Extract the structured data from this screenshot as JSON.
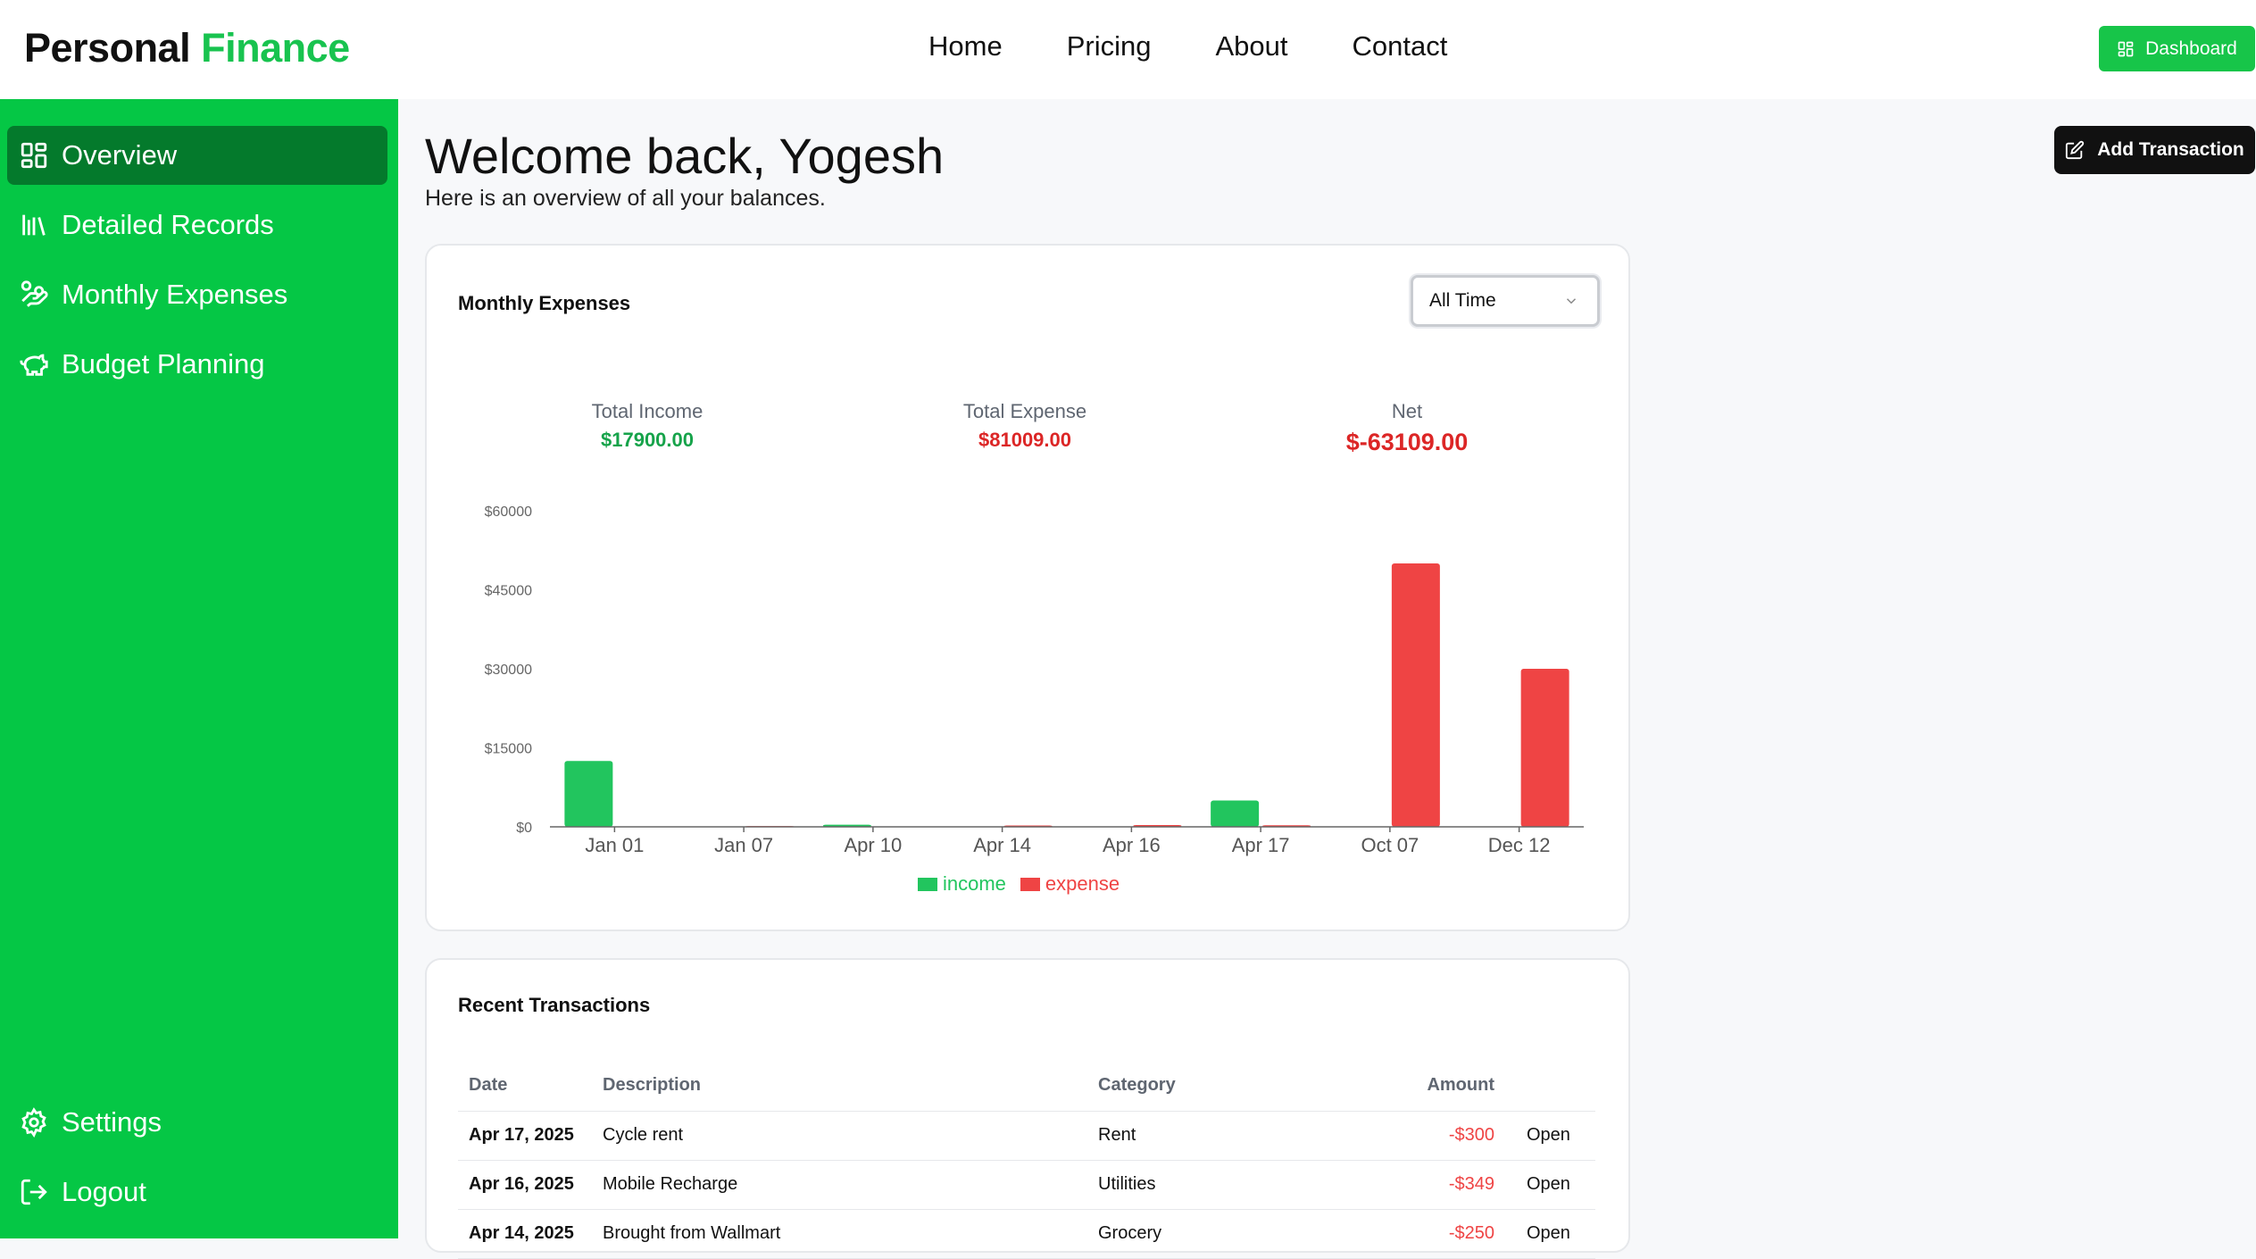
{
  "brand": {
    "part1": "Personal",
    "part2": "Finance"
  },
  "nav": {
    "home": "Home",
    "pricing": "Pricing",
    "about": "About",
    "contact": "Contact"
  },
  "header": {
    "dashboard_label": "Dashboard"
  },
  "sidebar": {
    "items": [
      {
        "label": "Overview",
        "icon": "layout-grid-icon",
        "active": true
      },
      {
        "label": "Detailed Records",
        "icon": "library-icon"
      },
      {
        "label": "Monthly Expenses",
        "icon": "hand-coins-icon"
      },
      {
        "label": "Budget Planning",
        "icon": "piggy-bank-icon"
      }
    ],
    "bottom": [
      {
        "label": "Settings",
        "icon": "gear-icon"
      },
      {
        "label": "Logout",
        "icon": "logout-icon"
      }
    ]
  },
  "main": {
    "welcome": "Welcome back, Yogesh",
    "subtitle": "Here is an overview of all your balances.",
    "add_transaction": "Add Transaction"
  },
  "expenses_card": {
    "title": "Monthly Expenses",
    "filter": "All Time",
    "stats": {
      "income_label": "Total Income",
      "income_value": "$17900.00",
      "expense_label": "Total Expense",
      "expense_value": "$81009.00",
      "net_label": "Net",
      "net_value": "$-63109.00"
    }
  },
  "chart_data": {
    "type": "bar",
    "categories": [
      "Jan 01",
      "Jan 07",
      "Apr 10",
      "Apr 14",
      "Apr 16",
      "Apr 17",
      "Oct 07",
      "Dec 12"
    ],
    "series": [
      {
        "name": "income",
        "color": "#22c55e",
        "values": [
          12500,
          0,
          400,
          0,
          0,
          5000,
          0,
          0
        ]
      },
      {
        "name": "expense",
        "color": "#ef4444",
        "values": [
          0,
          150,
          0,
          250,
          349,
          300,
          50000,
          30000
        ]
      }
    ],
    "yticks": [
      "$0",
      "$15000",
      "$30000",
      "$45000",
      "$60000"
    ],
    "ylim": [
      0,
      60000
    ],
    "legend": "bottom"
  },
  "transactions": {
    "title": "Recent Transactions",
    "columns": {
      "date": "Date",
      "description": "Description",
      "category": "Category",
      "amount": "Amount"
    },
    "rows": [
      {
        "date": "Apr 17, 2025",
        "description": "Cycle rent",
        "category": "Rent",
        "amount": "-$300",
        "action": "Open"
      },
      {
        "date": "Apr 16, 2025",
        "description": "Mobile Recharge",
        "category": "Utilities",
        "amount": "-$349",
        "action": "Open"
      },
      {
        "date": "Apr 14, 2025",
        "description": "Brought from Wallmart",
        "category": "Grocery",
        "amount": "-$250",
        "action": "Open"
      }
    ]
  }
}
